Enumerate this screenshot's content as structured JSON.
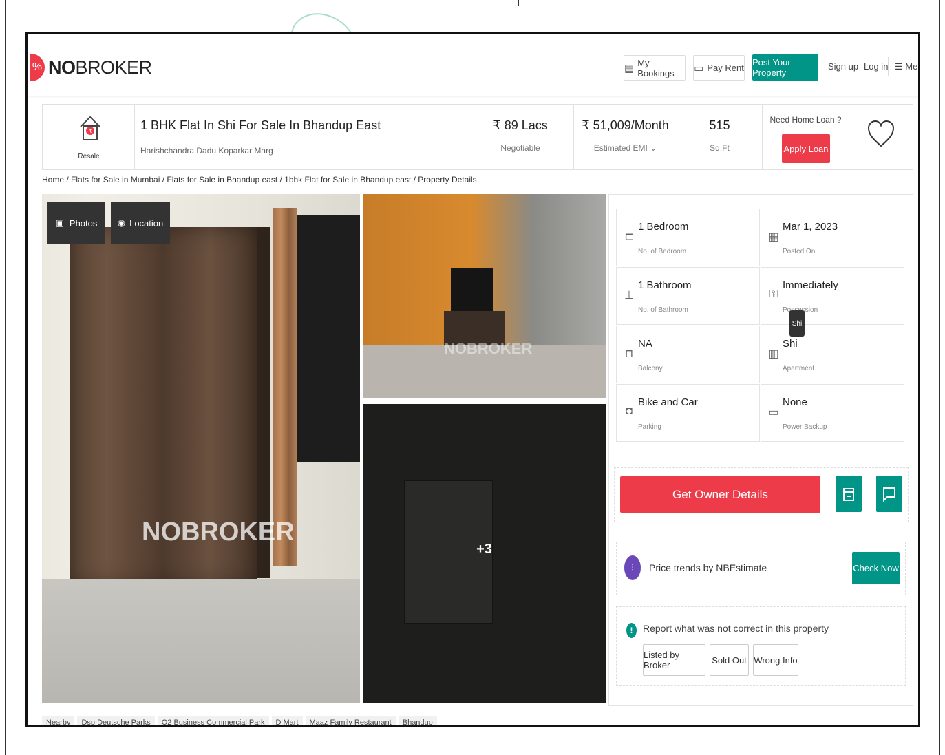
{
  "header": {
    "logo_bold": "NO",
    "logo_rest": "BROKER",
    "my_bookings": "My Bookings",
    "pay_rent": "Pay Rent",
    "post_property": "Post Your Property",
    "sign_up": "Sign up",
    "log_in": "Log in",
    "menu": "Men"
  },
  "summary": {
    "resale_label": "Resale",
    "title": "1 BHK Flat In Shi For Sale In Bhandup East",
    "address": "Harishchandra Dadu Koparkar Marg",
    "price": "₹ 89 Lacs",
    "price_sub": "Negotiable",
    "emi": "₹ 51,009/Month",
    "emi_sub": "Estimated EMI ⌄",
    "area": "515",
    "area_sub": "Sq.Ft",
    "loan_question": "Need Home Loan ?",
    "apply_loan": "Apply Loan"
  },
  "breadcrumb": "Home / Flats for Sale in Mumbai / Flats for Sale in Bhandup east / 1bhk Flat for Sale in Bhandup east / Property Details",
  "gallery": {
    "photos_btn": "Photos",
    "location_btn": "Location",
    "watermark": "NOBROKER",
    "more_count": "+3"
  },
  "details": [
    {
      "value": "1 Bedroom",
      "label": "No. of Bedroom",
      "icon": "bed-icon"
    },
    {
      "value": "Mar 1, 2023",
      "label": "Posted On",
      "icon": "calendar-icon"
    },
    {
      "value": "1 Bathroom",
      "label": "No. of Bathroom",
      "icon": "bathroom-icon"
    },
    {
      "value": "Immediately",
      "label": "Possession",
      "icon": "key-icon"
    },
    {
      "value": "NA",
      "label": "Balcony",
      "icon": "balcony-icon"
    },
    {
      "value": "Shi",
      "label": "Apartment",
      "icon": "building-icon"
    },
    {
      "value": "Bike and Car",
      "label": "Parking",
      "icon": "car-icon"
    },
    {
      "value": "None",
      "label": "Power Backup",
      "icon": "battery-icon"
    }
  ],
  "tooltip": "Shi",
  "actions": {
    "owner_details": "Get Owner Details",
    "nb_text": "Price trends by NBEstimate",
    "check_now": "Check Now",
    "report_text": "Report what was not correct in this property",
    "chip_broker": "Listed by Broker",
    "chip_sold": "Sold Out",
    "chip_wrong": "Wrong Info"
  },
  "nearby": [
    "Nearby",
    "Dsp Deutsche Parks",
    "O2 Business Commercial Park",
    "D Mart",
    "Maaz Family Restaurant",
    "Bhandup"
  ],
  "colors": {
    "brand_red": "#ed3b4a",
    "brand_teal": "#009587"
  }
}
